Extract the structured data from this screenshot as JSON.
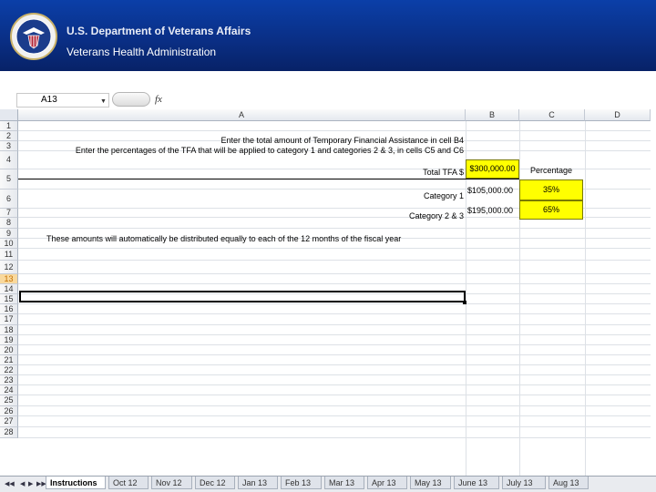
{
  "header": {
    "org": "U.S. Department of Veterans Affairs",
    "subtitle": "Veterans Health Administration",
    "seal_icon": "va-seal-icon"
  },
  "formula_bar": {
    "name_box": "A13",
    "fx": "fx",
    "formula": ""
  },
  "columns": [
    "A",
    "B",
    "C",
    "D"
  ],
  "rows": [
    "1",
    "2",
    "3",
    "4",
    "5",
    "6",
    "7",
    "8",
    "9",
    "10",
    "11",
    "12",
    "13",
    "14",
    "15",
    "16",
    "17",
    "18",
    "19",
    "20",
    "21",
    "22",
    "23",
    "24",
    "25",
    "26",
    "27",
    "28"
  ],
  "selected_row": "13",
  "cells": {
    "a2": "Enter the total amount of Temporary Financial Assistance in cell B4",
    "a3": "Enter the percentages of the TFA that will be applied to category 1 and categories 2 & 3, in cells C5 and C6",
    "a4": "Total TFA $",
    "b4": "$300,000.00",
    "c4": "Percentage",
    "a5": "Category 1",
    "b5": "$105,000.00",
    "c5": "35%",
    "a6": "Category 2 & 3",
    "b6": "$195,000.00",
    "c6": "65%",
    "a8": "These amounts will automatically be distributed equally to each of the 12 months of the fiscal year"
  },
  "sheet_tabs": [
    "Instructions",
    "Oct 12",
    "Nov 12",
    "Dec 12",
    "Jan 13",
    "Feb 13",
    "Mar 13",
    "Apr 13",
    "May 13",
    "June 13",
    "July 13",
    "Aug 13"
  ],
  "active_tab": "Instructions",
  "colors": {
    "banner": "#0a2f86",
    "input_fill": "#ffff00"
  }
}
